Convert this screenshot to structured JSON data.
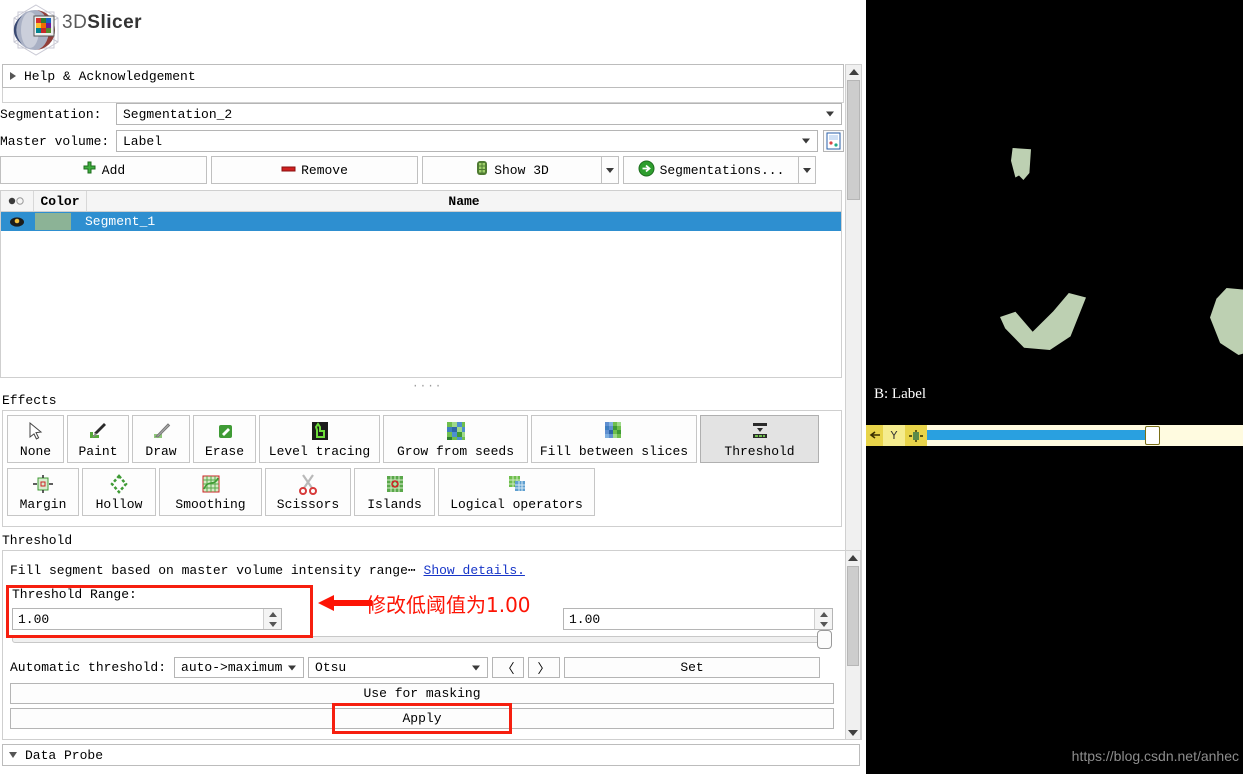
{
  "app": {
    "name": "3DSlicer",
    "name_prefix": "3D",
    "name_suffix": "Slicer",
    "logo_icon": "slicer-logo-icon"
  },
  "help_section": {
    "label": "Help & Acknowledgement",
    "expander_icon": "chevron-right-icon"
  },
  "segmentation": {
    "label": "Segmentation:",
    "value": "Segmentation_2",
    "dropdown_icon": "chevron-down-icon"
  },
  "master_volume": {
    "label": "Master volume:",
    "value": "Label",
    "dropdown_icon": "chevron-down-icon",
    "side_button_icon": "volume-properties-icon"
  },
  "toolbar": {
    "add_label": "Add",
    "add_icon": "green-plus-icon",
    "remove_label": "Remove",
    "remove_icon": "red-minus-icon",
    "show3d_label": "Show 3D",
    "show3d_icon": "3d-cube-icon",
    "segmentations_label": "Segmentations...",
    "segmentations_icon": "green-arrow-circle-icon",
    "split_caret_icon": "chevron-down-icon"
  },
  "segment_table": {
    "columns": [
      "",
      "Color",
      "Name"
    ],
    "eye_icon": "visibility-eye-icon",
    "rows": [
      {
        "visible_icon": "eye-open-icon",
        "color": "#8cb396",
        "name": "Segment_1",
        "selected": true
      }
    ]
  },
  "effects": {
    "title": "Effects",
    "items": [
      {
        "label": "None",
        "icon": "cursor-arrow-icon",
        "selected": false
      },
      {
        "label": "Paint",
        "icon": "paint-brush-icon",
        "selected": false
      },
      {
        "label": "Draw",
        "icon": "draw-pencil-icon",
        "selected": false
      },
      {
        "label": "Erase",
        "icon": "eraser-icon",
        "selected": false
      },
      {
        "label": "Level tracing",
        "icon": "level-tracing-icon",
        "selected": false
      },
      {
        "label": "Grow from seeds",
        "icon": "grow-from-seeds-icon",
        "selected": false
      },
      {
        "label": "Fill between slices",
        "icon": "fill-between-slices-icon",
        "selected": false
      },
      {
        "label": "Threshold",
        "icon": "threshold-icon",
        "selected": true
      },
      {
        "label": "Margin",
        "icon": "margin-icon",
        "selected": false
      },
      {
        "label": "Hollow",
        "icon": "hollow-icon",
        "selected": false
      },
      {
        "label": "Smoothing",
        "icon": "smoothing-icon",
        "selected": false
      },
      {
        "label": "Scissors",
        "icon": "scissors-icon",
        "selected": false
      },
      {
        "label": "Islands",
        "icon": "islands-icon",
        "selected": false
      },
      {
        "label": "Logical operators",
        "icon": "logical-operators-icon",
        "selected": false
      }
    ]
  },
  "threshold": {
    "title": "Threshold",
    "description": "Fill segment based on master volume intensity range⋯",
    "show_details_link": "Show details.",
    "range_label": "Threshold Range:",
    "min_value": "1.00",
    "max_value": "1.00",
    "spin_up_icon": "spinner-up-icon",
    "spin_down_icon": "spinner-down-icon",
    "automatic_label": "Automatic threshold:",
    "automatic_mode": "auto->maximum",
    "automatic_method": "Otsu",
    "prev_label": "〈",
    "next_label": "〉",
    "set_label": "Set",
    "use_for_masking_label": "Use for masking",
    "apply_label": "Apply"
  },
  "annotation": {
    "text": "修改低阈值为1.00",
    "color": "#fd1405",
    "arrow_icon": "left-arrow-annotation-icon",
    "highlight_color": "#f61f0f"
  },
  "data_probe": {
    "label": "Data Probe",
    "expander_icon": "chevron-down-icon"
  },
  "viewport": {
    "slice_label": "B: Label",
    "background_color": "#000000",
    "segment_overlay_color": "#bdd0b2",
    "slice_bar": {
      "color": "#e8d44a",
      "axis_label": "Y",
      "pin_icon": "pin-icon",
      "reslice_icon": "reslice-crosshair-icon",
      "fill_color": "#29a0e0",
      "slider_percent": 73
    }
  },
  "watermark": {
    "text": "https://blog.csdn.net/anhec"
  }
}
